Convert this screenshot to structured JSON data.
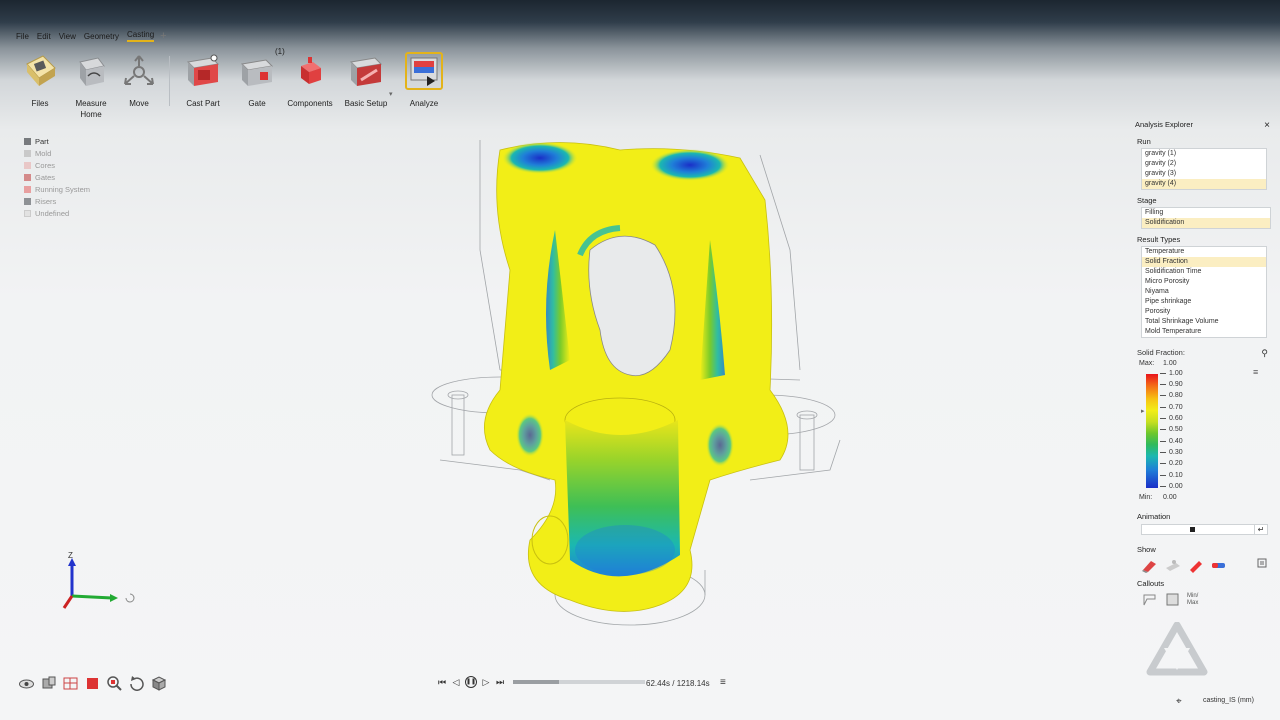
{
  "menu": {
    "items": [
      "File",
      "Edit",
      "View",
      "Geometry",
      "Casting"
    ],
    "active": "Casting",
    "add": "+"
  },
  "ribbon": {
    "tools": [
      {
        "label": "Files",
        "icon": "files-icon"
      },
      {
        "label": "Measure",
        "icon": "measure-icon",
        "sub": "Home"
      },
      {
        "label": "Move",
        "icon": "move-icon"
      },
      {
        "label": "Cast Part",
        "icon": "cast-part-icon"
      },
      {
        "label": "Gate",
        "icon": "gate-icon",
        "badge": "(1)"
      },
      {
        "label": "Components",
        "icon": "components-icon"
      },
      {
        "label": "Basic Setup",
        "icon": "basic-setup-icon"
      },
      {
        "label": "Analyze",
        "icon": "analyze-icon"
      }
    ],
    "dropdown_glyph": "▾"
  },
  "layers": [
    {
      "label": "Part",
      "color": "#777a7d",
      "active": true
    },
    {
      "label": "Mold",
      "color": "#c9c9c9",
      "active": false
    },
    {
      "label": "Cores",
      "color": "#e9c7c7",
      "active": false
    },
    {
      "label": "Gates",
      "color": "#d48a8a",
      "active": false
    },
    {
      "label": "Running System",
      "color": "#e8a0a0",
      "active": false
    },
    {
      "label": "Risers",
      "color": "#8e9195",
      "active": false
    },
    {
      "label": "Undefined",
      "color": "#e2e2e2",
      "active": false
    }
  ],
  "panel": {
    "title": "Analysis Explorer",
    "close": "×",
    "run_label": "Run",
    "runs": [
      "gravity (1)",
      "gravity (2)",
      "gravity (3)",
      "gravity (4)"
    ],
    "run_selected": 3,
    "stage_label": "Stage",
    "stages": [
      "Filling",
      "Solidification"
    ],
    "stage_selected": 1,
    "result_label": "Result Types",
    "results": [
      "Temperature",
      "Solid Fraction",
      "Solidification Time",
      "Micro Porosity",
      "Niyama",
      "Pipe shrinkage",
      "Porosity",
      "Total Shrinkage Volume",
      "Mold Temperature"
    ],
    "result_selected": 1,
    "legend_title": "Solid Fraction:",
    "legend_max_label": "Max:",
    "legend_max": "1.00",
    "legend_min_label": "Min:",
    "legend_min": "0.00",
    "legend_ticks": [
      "1.00",
      "0.90",
      "0.80",
      "0.70",
      "0.60",
      "0.50",
      "0.40",
      "0.30",
      "0.20",
      "0.10",
      "0.00"
    ],
    "legend_marker_value": 0.7,
    "animation_label": "Animation",
    "show_label": "Show",
    "callouts_label": "Callouts",
    "callouts_minmax": "Min/ Max"
  },
  "playback": {
    "time": "62.44s / 1218.14s",
    "progress": 0.35
  },
  "status": {
    "units": "casting_IS (mm)"
  },
  "axes": {
    "z": "Z"
  }
}
